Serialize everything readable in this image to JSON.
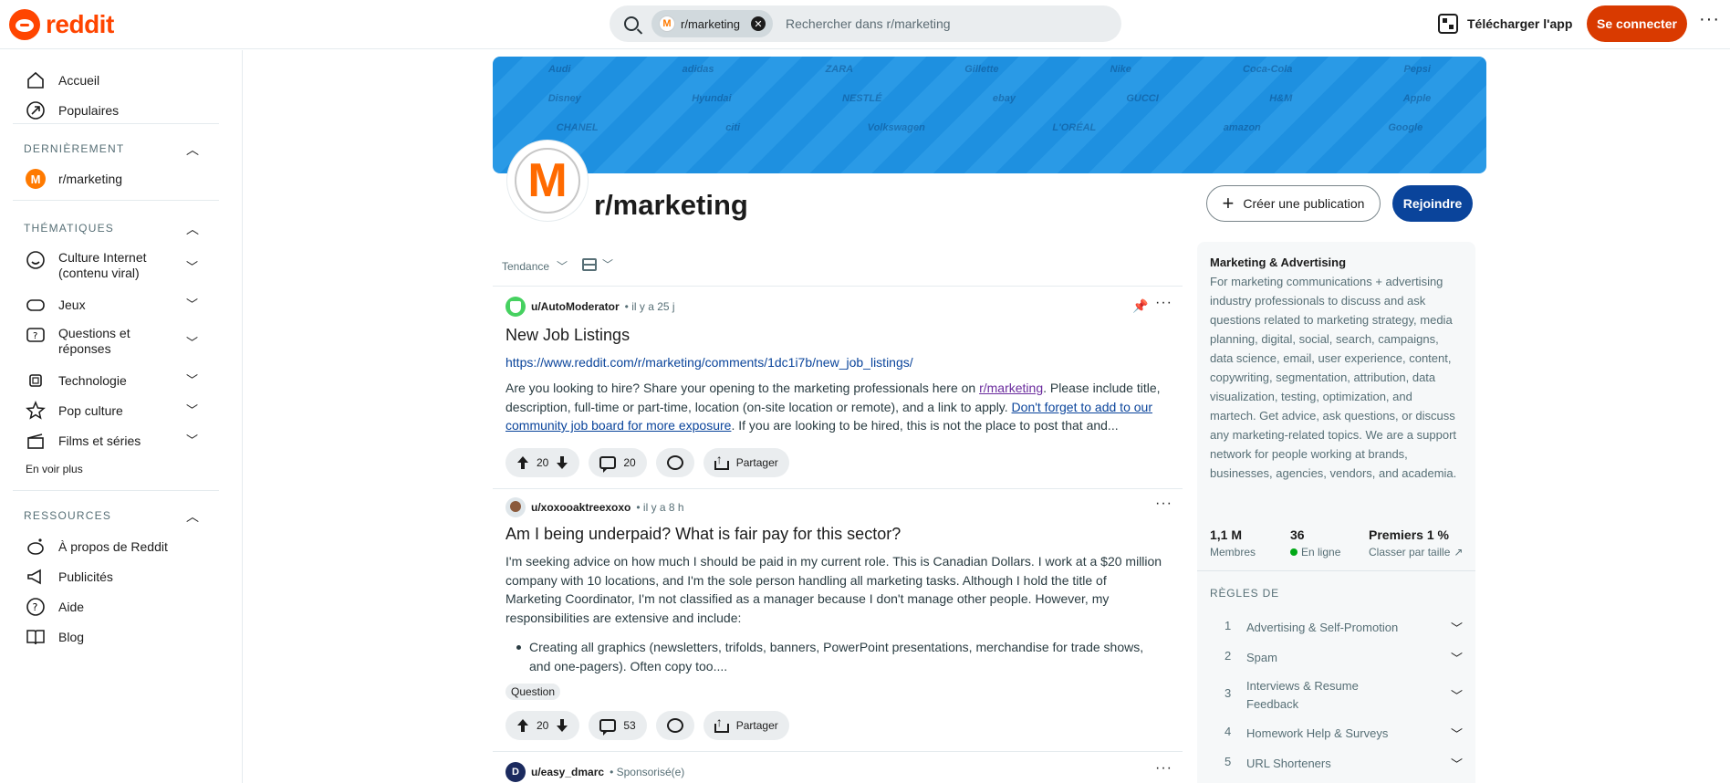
{
  "header": {
    "logo_text": "reddit",
    "search_chip": "r/marketing",
    "search_placeholder": "Rechercher dans r/marketing",
    "app_button": "Télécharger l'app",
    "login_button": "Se connecter",
    "more": "···"
  },
  "sidebar": {
    "home": "Accueil",
    "popular": "Populaires",
    "recent_header": "DERNIÈREMENT",
    "recent_items": [
      "r/marketing"
    ],
    "topics_header": "THÉMATIQUES",
    "topics": [
      {
        "label": "Culture Internet (contenu viral)",
        "icon": "smile-icon"
      },
      {
        "label": "Jeux",
        "icon": "gamepad-icon"
      },
      {
        "label": "Questions et réponses",
        "icon": "question-bubble-icon"
      },
      {
        "label": "Technologie",
        "icon": "chip-icon"
      },
      {
        "label": "Pop culture",
        "icon": "star-icon"
      },
      {
        "label": "Films et séries",
        "icon": "clapperboard-icon"
      }
    ],
    "see_more": "En voir plus",
    "resources_header": "RESSOURCES",
    "resources": [
      {
        "label": "À propos de Reddit",
        "icon": "reddit-alien-icon"
      },
      {
        "label": "Publicités",
        "icon": "megaphone-icon"
      },
      {
        "label": "Aide",
        "icon": "help-icon"
      },
      {
        "label": "Blog",
        "icon": "book-icon"
      }
    ]
  },
  "subreddit": {
    "name": "r/marketing",
    "avatar_letter": "M",
    "create_post": "Créer une publication",
    "join": "Rejoindre",
    "banner_brands": [
      "Audi",
      "adidas",
      "ZARA",
      "Gillette",
      "Nike",
      "Disney",
      "Hyundai",
      "NESTLÉ",
      "ebay",
      "GUCCI",
      "H&M",
      "Apple",
      "CHANEL",
      "citi",
      "Volkswagen",
      "L'ORÉAL",
      "amazon",
      "Google",
      "Coca-Cola",
      "Pepsi"
    ]
  },
  "feed": {
    "sort_label": "Tendance",
    "posts": [
      {
        "author": "u/AutoModerator",
        "time": "• il y a 25 j",
        "title": "New Job Listings",
        "link": "https://www.reddit.com/r/marketing/comments/1dc1i7b/new_job_listings/",
        "body_1": "Are you looking to hire? Share your opening to the marketing professionals here on ",
        "body_link_1": "r/marketing",
        "body_2": ". Please include title, description, full-time or part-time, location (on-site location or remote), and a link to apply. ",
        "body_link_2": "Don't forget to add to our community job board for more exposure",
        "body_3": ". If you are looking to be hired, this is not the place to post that and...",
        "votes": "20",
        "comments": "20",
        "share": "Partager"
      },
      {
        "author": "u/xoxooaktreexoxo",
        "time": "• il y a 8 h",
        "title": "Am I being underpaid? What is fair pay for this sector?",
        "body": "I'm seeking advice on how much I should be paid in my current role. This is Canadian Dollars. I work at a $20 million company with 10 locations, and I'm the sole person handling all marketing tasks. Although I hold the title of Marketing Coordinator, I'm not classified as a manager because I don't manage other people. However, my responsibilities are extensive and include:",
        "bullet": "Creating all graphics (newsletters, trifolds, banners, PowerPoint presentations, merchandise for trade shows, and one-pagers). Often copy too....",
        "flair": "Question",
        "votes": "20",
        "comments": "53",
        "share": "Partager"
      },
      {
        "author": "u/easy_dmarc",
        "time": "• Sponsorisé(e)"
      }
    ]
  },
  "about": {
    "title": "Marketing & Advertising",
    "description": "For marketing communications + advertising industry professionals to discuss and ask questions related to marketing strategy, media planning, digital, social, search, campaigns, data science, email, user experience, content, copywriting, segmentation, attribution, data visualization, testing, optimization, and martech. Get advice, ask questions, or discuss any marketing-related topics. We are a support network for people working at brands, businesses, agencies, vendors, and academia.",
    "members_value": "1,1 M",
    "members_label": "Membres",
    "online_value": "36",
    "online_label": "En ligne",
    "rank_value": "Premiers 1 %",
    "rank_label": "Classer par taille",
    "rules_header": "RÈGLES DE",
    "rules": [
      {
        "num": "1",
        "text": "Advertising & Self-Promotion"
      },
      {
        "num": "2",
        "text": "Spam"
      },
      {
        "num": "3",
        "text": "Interviews & Resume Feedback"
      },
      {
        "num": "4",
        "text": "Homework Help & Surveys"
      },
      {
        "num": "5",
        "text": "URL Shorteners"
      }
    ]
  },
  "colors": {
    "reddit_orange": "#ff4500",
    "login_bg": "#d93a00",
    "join_bg": "#0a449b",
    "banner_blue": "#1e90e0",
    "online_green": "#01a816"
  }
}
